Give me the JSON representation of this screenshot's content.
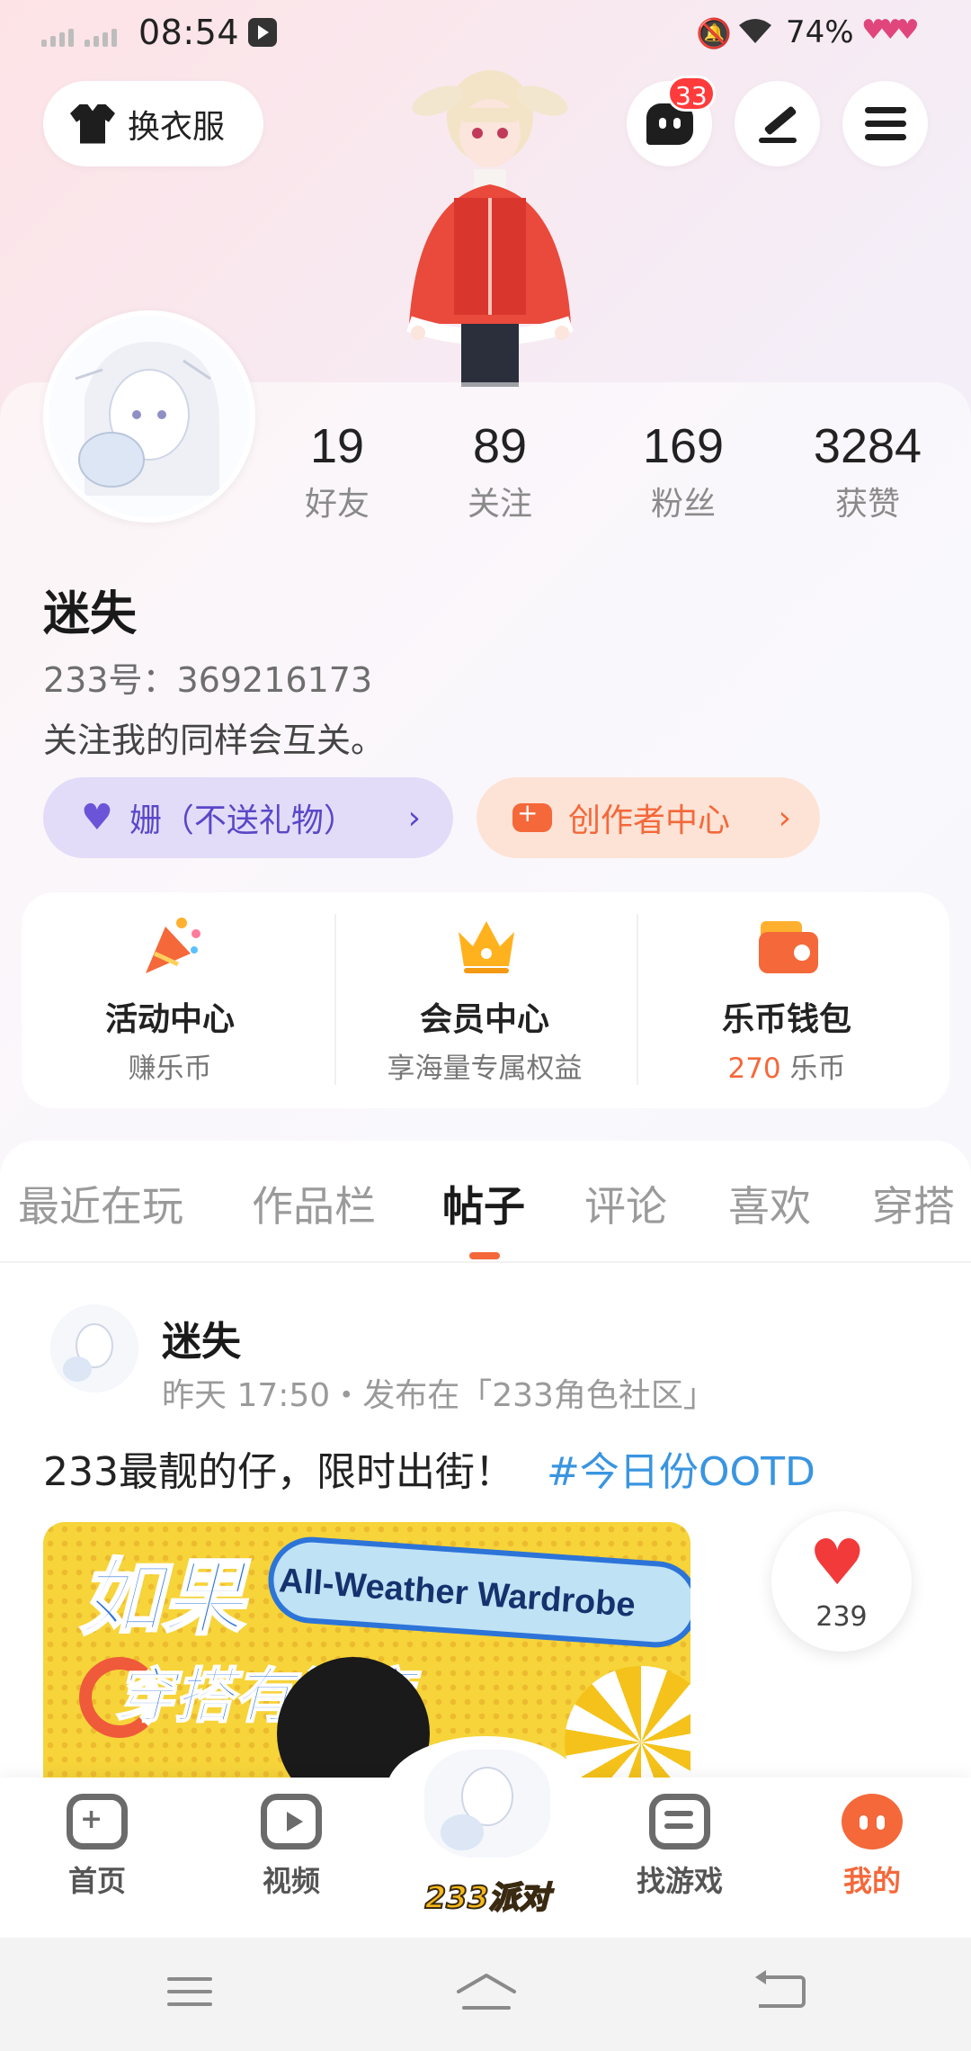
{
  "status_bar": {
    "time": "08:54",
    "battery": "74%"
  },
  "header": {
    "outfit_label": "换衣服",
    "message_badge": "33"
  },
  "profile": {
    "stats": [
      {
        "value": "19",
        "label": "好友"
      },
      {
        "value": "89",
        "label": "关注"
      },
      {
        "value": "169",
        "label": "粉丝"
      },
      {
        "value": "3284",
        "label": "获赞"
      }
    ],
    "name": "迷失",
    "id_text": "233号：369216173",
    "bio": "关注我的同样会互关。",
    "tag_purple": "姗（不送礼物）",
    "tag_orange": "创作者中心",
    "arrow": "›"
  },
  "features": [
    {
      "title": "活动中心",
      "sub": "赚乐币"
    },
    {
      "title": "会员中心",
      "sub": "享海量专属权益"
    },
    {
      "title": "乐币钱包",
      "sub_value": "270",
      "sub_unit": "乐币"
    }
  ],
  "tabs": [
    {
      "label": "最近在玩"
    },
    {
      "label": "作品栏"
    },
    {
      "label": "帖子",
      "active": true
    },
    {
      "label": "评论"
    },
    {
      "label": "喜欢"
    },
    {
      "label": "穿搭"
    }
  ],
  "post": {
    "author": "迷失",
    "meta": "昨天 17:50・发布在「233角色社区」",
    "text": "233最靓的仔，限时出街！",
    "hashtag": "#今日份OOTD",
    "image_title": "如果",
    "image_banner": "All-Weather Wardrobe",
    "image_line2": "穿搭有温度",
    "likes": "239"
  },
  "bottom_nav": [
    {
      "label": "首页",
      "icon": "gamepad-icon"
    },
    {
      "label": "视频",
      "icon": "play-icon"
    },
    {
      "label": "233派对",
      "icon": "party-avatar"
    },
    {
      "label": "找游戏",
      "icon": "list-icon"
    },
    {
      "label": "我的",
      "icon": "me-icon",
      "active": true
    }
  ],
  "colors": {
    "accent": "#f4683a",
    "purple": "#5a47c7",
    "link": "#3a95e0"
  }
}
